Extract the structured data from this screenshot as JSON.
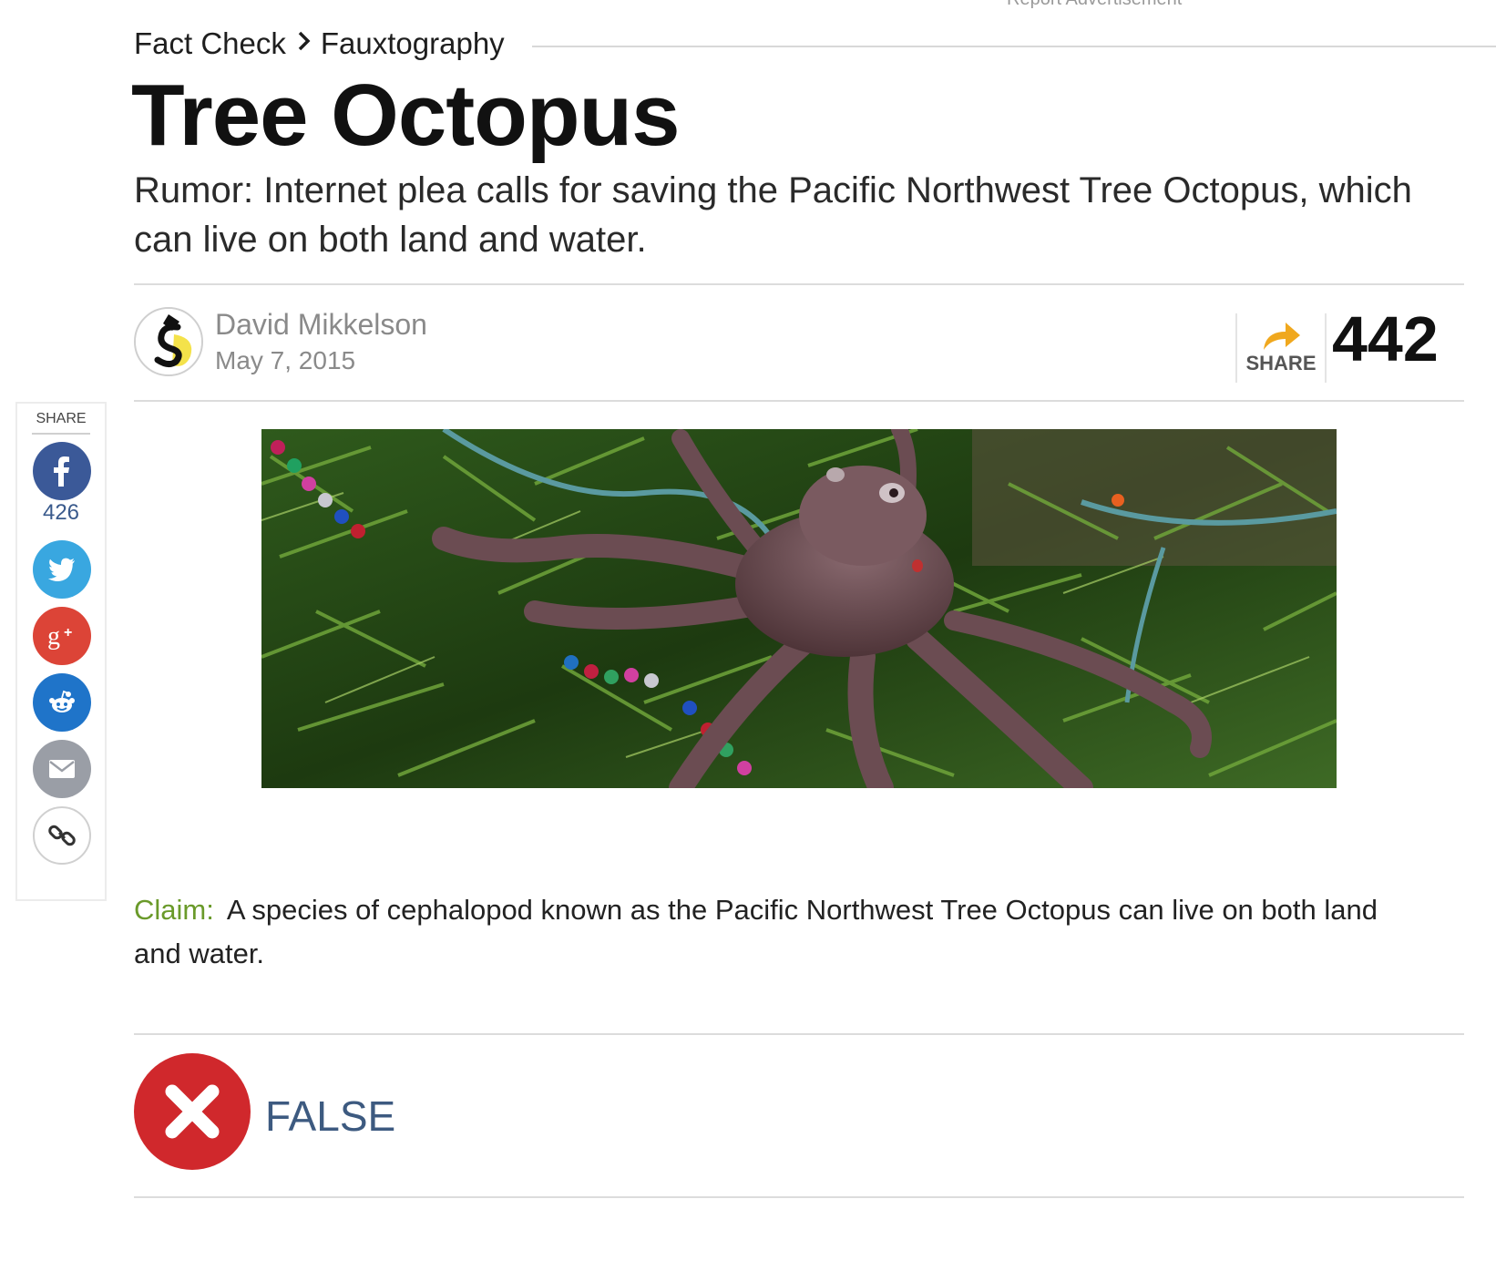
{
  "ad": {
    "label": "Report Advertisement"
  },
  "breadcrumb": {
    "section": "Fact Check",
    "separator": "›",
    "category": "Fauxtography"
  },
  "article": {
    "title": "Tree Octopus",
    "subtitle": "Rumor: Internet plea calls for saving the Pacific Northwest Tree Octopus, which can live on both land and water.",
    "author": "David Mikkelson",
    "date": "May 7, 2015",
    "share_label": "SHARE",
    "share_count": "442"
  },
  "sidebar": {
    "label": "SHARE",
    "facebook_count": "426",
    "buttons": [
      {
        "name": "facebook",
        "icon": "facebook-icon",
        "color": "#3b5998"
      },
      {
        "name": "twitter",
        "icon": "twitter-icon",
        "color": "#39a7e0"
      },
      {
        "name": "google-plus",
        "icon": "google-plus-icon",
        "color": "#dc4437"
      },
      {
        "name": "reddit",
        "icon": "reddit-icon",
        "color": "#1f74c9"
      },
      {
        "name": "email",
        "icon": "envelope-icon",
        "color": "#9a9ea6"
      },
      {
        "name": "copy-link",
        "icon": "link-icon",
        "color": "#ffffff"
      }
    ]
  },
  "claim": {
    "label": "Claim:",
    "text": "A species of cephalopod known as the Pacific Northwest Tree Octopus can live on both land and water."
  },
  "rating": {
    "label": "FALSE",
    "color": "#d0282c"
  },
  "colors": {
    "accent": "#3d5a80",
    "claim_label": "#6a9a2a",
    "share_arrow": "#f0a81e"
  }
}
